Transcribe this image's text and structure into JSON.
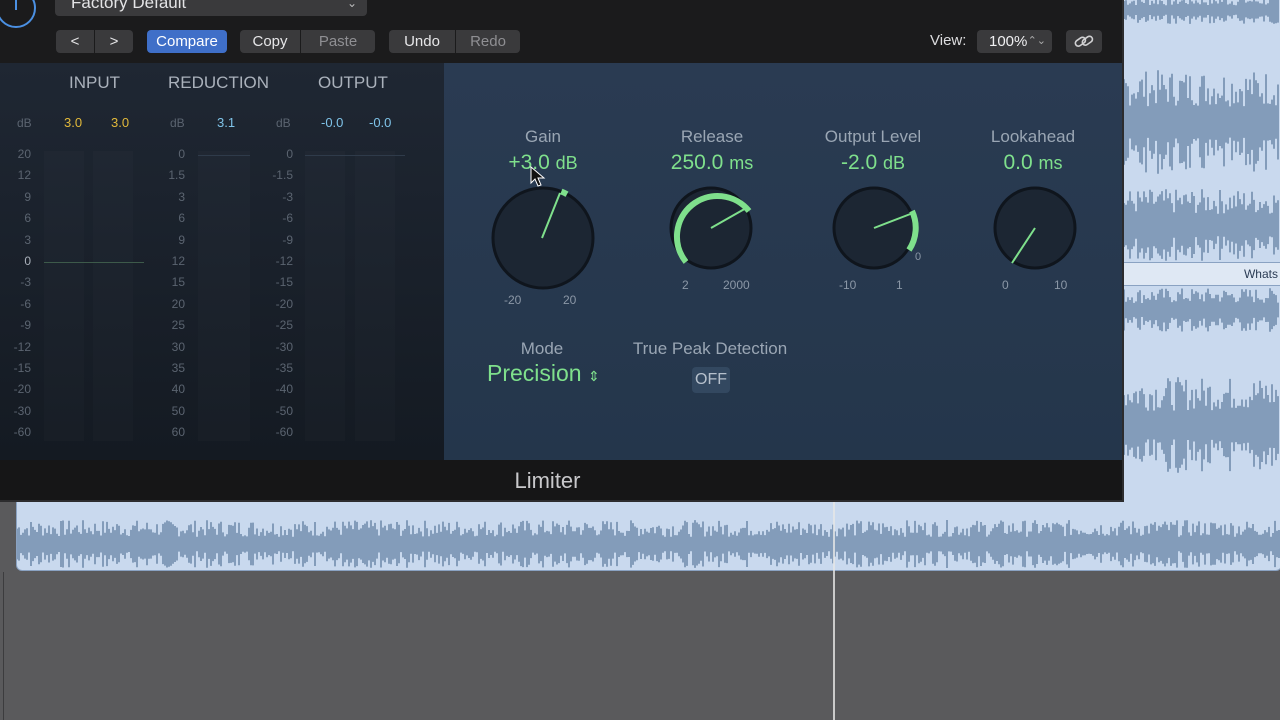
{
  "header": {
    "preset": "Factory Default",
    "buttons": {
      "prev": "<",
      "next": ">",
      "compare": "Compare",
      "copy": "Copy",
      "paste": "Paste",
      "undo": "Undo",
      "redo": "Redo"
    },
    "view_label": "View:",
    "view_value": "100%"
  },
  "meters": {
    "input": {
      "label": "INPUT",
      "db": "dB",
      "peaks": [
        "3.0",
        "3.0"
      ]
    },
    "reduction": {
      "label": "REDUCTION",
      "db": "dB",
      "peak": "3.1"
    },
    "output": {
      "label": "OUTPUT",
      "db": "dB",
      "peaks": [
        "-0.0",
        "-0.0"
      ]
    },
    "input_scale": [
      "20",
      "12",
      "9",
      "6",
      "3",
      "0",
      "-3",
      "-6",
      "-9",
      "-12",
      "-15",
      "-20",
      "-30",
      "-60"
    ],
    "reduction_scale": [
      "0",
      "1.5",
      "3",
      "6",
      "9",
      "12",
      "15",
      "20",
      "25",
      "30",
      "35",
      "40",
      "50",
      "60"
    ],
    "output_scale": [
      "0",
      "-1.5",
      "-3",
      "-6",
      "-9",
      "-12",
      "-15",
      "-20",
      "-25",
      "-30",
      "-35",
      "-40",
      "-50",
      "-60"
    ]
  },
  "params": {
    "gain": {
      "label": "Gain",
      "value": "+3.0",
      "unit": "dB",
      "min": "-20",
      "max": "20"
    },
    "release": {
      "label": "Release",
      "value": "250.0",
      "unit": "ms",
      "min": "2",
      "max": "2000"
    },
    "output_level": {
      "label": "Output Level",
      "value": "-2.0",
      "unit": "dB",
      "min": "-10",
      "max": "1",
      "extra": "0"
    },
    "lookahead": {
      "label": "Lookahead",
      "value": "0.0",
      "unit": "ms",
      "min": "0",
      "max": "10"
    },
    "mode": {
      "label": "Mode",
      "value": "Precision"
    },
    "true_peak": {
      "label": "True Peak Detection",
      "value": "OFF"
    }
  },
  "plugin_name": "Limiter",
  "track_label": "Whats",
  "colors": {
    "accent_green": "#7fe08c",
    "accent_blue": "#3f6fc8",
    "waveform": "#3d5f86"
  }
}
